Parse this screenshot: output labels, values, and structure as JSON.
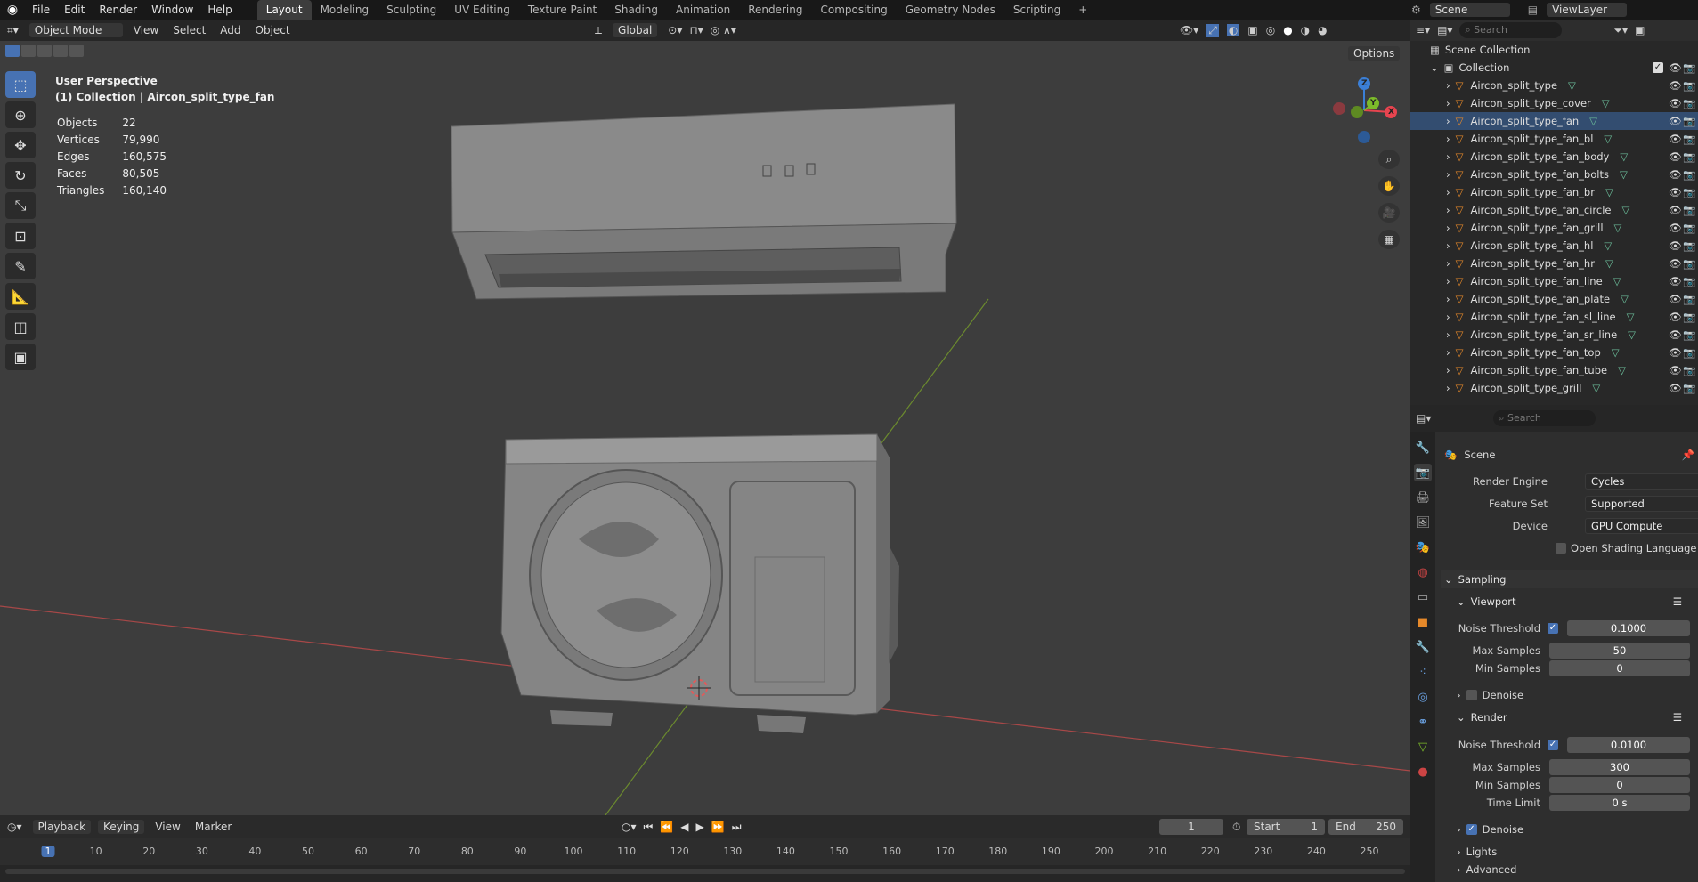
{
  "topbar": {
    "menus": [
      "File",
      "Edit",
      "Render",
      "Window",
      "Help"
    ],
    "workspaces": [
      "Layout",
      "Modeling",
      "Sculpting",
      "UV Editing",
      "Texture Paint",
      "Shading",
      "Animation",
      "Rendering",
      "Compositing",
      "Geometry Nodes",
      "Scripting"
    ],
    "active_workspace": "Layout",
    "scene_label": "Scene",
    "viewlayer_label": "ViewLayer"
  },
  "viewport_header": {
    "mode": "Object Mode",
    "menus": [
      "View",
      "Select",
      "Add",
      "Object"
    ],
    "orientation": "Global",
    "options_label": "Options"
  },
  "viewport": {
    "perspective": "User Perspective",
    "context": "(1) Collection | Aircon_split_type_fan",
    "stats": [
      {
        "label": "Objects",
        "value": "22"
      },
      {
        "label": "Vertices",
        "value": "79,990"
      },
      {
        "label": "Edges",
        "value": "160,575"
      },
      {
        "label": "Faces",
        "value": "80,505"
      },
      {
        "label": "Triangles",
        "value": "160,140"
      }
    ],
    "gizmo": {
      "x": "X",
      "y": "Y",
      "z": "Z"
    }
  },
  "timeline": {
    "menus": [
      "Playback",
      "Keying",
      "View",
      "Marker"
    ],
    "current_frame": "1",
    "start_label": "Start",
    "start": "1",
    "end_label": "End",
    "end": "250",
    "ticks": [
      "1",
      "10",
      "20",
      "30",
      "40",
      "50",
      "60",
      "70",
      "80",
      "90",
      "100",
      "110",
      "120",
      "130",
      "140",
      "150",
      "160",
      "170",
      "180",
      "190",
      "200",
      "210",
      "220",
      "230",
      "240",
      "250"
    ]
  },
  "outliner": {
    "search_placeholder": "Search",
    "scene_collection": "Scene Collection",
    "collection": "Collection",
    "items": [
      "Aircon_split_type",
      "Aircon_split_type_cover",
      "Aircon_split_type_fan",
      "Aircon_split_type_fan_bl",
      "Aircon_split_type_fan_body",
      "Aircon_split_type_fan_bolts",
      "Aircon_split_type_fan_br",
      "Aircon_split_type_fan_circle",
      "Aircon_split_type_fan_grill",
      "Aircon_split_type_fan_hl",
      "Aircon_split_type_fan_hr",
      "Aircon_split_type_fan_line",
      "Aircon_split_type_fan_plate",
      "Aircon_split_type_fan_sl_line",
      "Aircon_split_type_fan_sr_line",
      "Aircon_split_type_fan_top",
      "Aircon_split_type_fan_tube",
      "Aircon_split_type_grill"
    ]
  },
  "properties": {
    "search_placeholder": "Search",
    "title": "Scene",
    "render_engine_label": "Render Engine",
    "render_engine": "Cycles",
    "feature_set_label": "Feature Set",
    "feature_set": "Supported",
    "device_label": "Device",
    "device": "GPU Compute",
    "osl_label": "Open Shading Language",
    "sampling": "Sampling",
    "viewport": "Viewport",
    "vp_noise_label": "Noise Threshold",
    "vp_noise": "0.1000",
    "vp_max_label": "Max Samples",
    "vp_max": "50",
    "vp_min_label": "Min Samples",
    "vp_min": "0",
    "denoise_label": "Denoise",
    "render": "Render",
    "r_noise_label": "Noise Threshold",
    "r_noise": "0.0100",
    "r_max_label": "Max Samples",
    "r_max": "300",
    "r_min_label": "Min Samples",
    "r_min": "0",
    "time_limit_label": "Time Limit",
    "time_limit": "0 s",
    "denoise2_label": "Denoise",
    "lights": "Lights",
    "advanced": "Advanced"
  },
  "colors": {
    "accent": "#4772b3",
    "x_axis": "#e8444f",
    "y_axis": "#7cbb2a",
    "z_axis": "#3b7fd6",
    "mesh_icon": "#e6892a"
  }
}
